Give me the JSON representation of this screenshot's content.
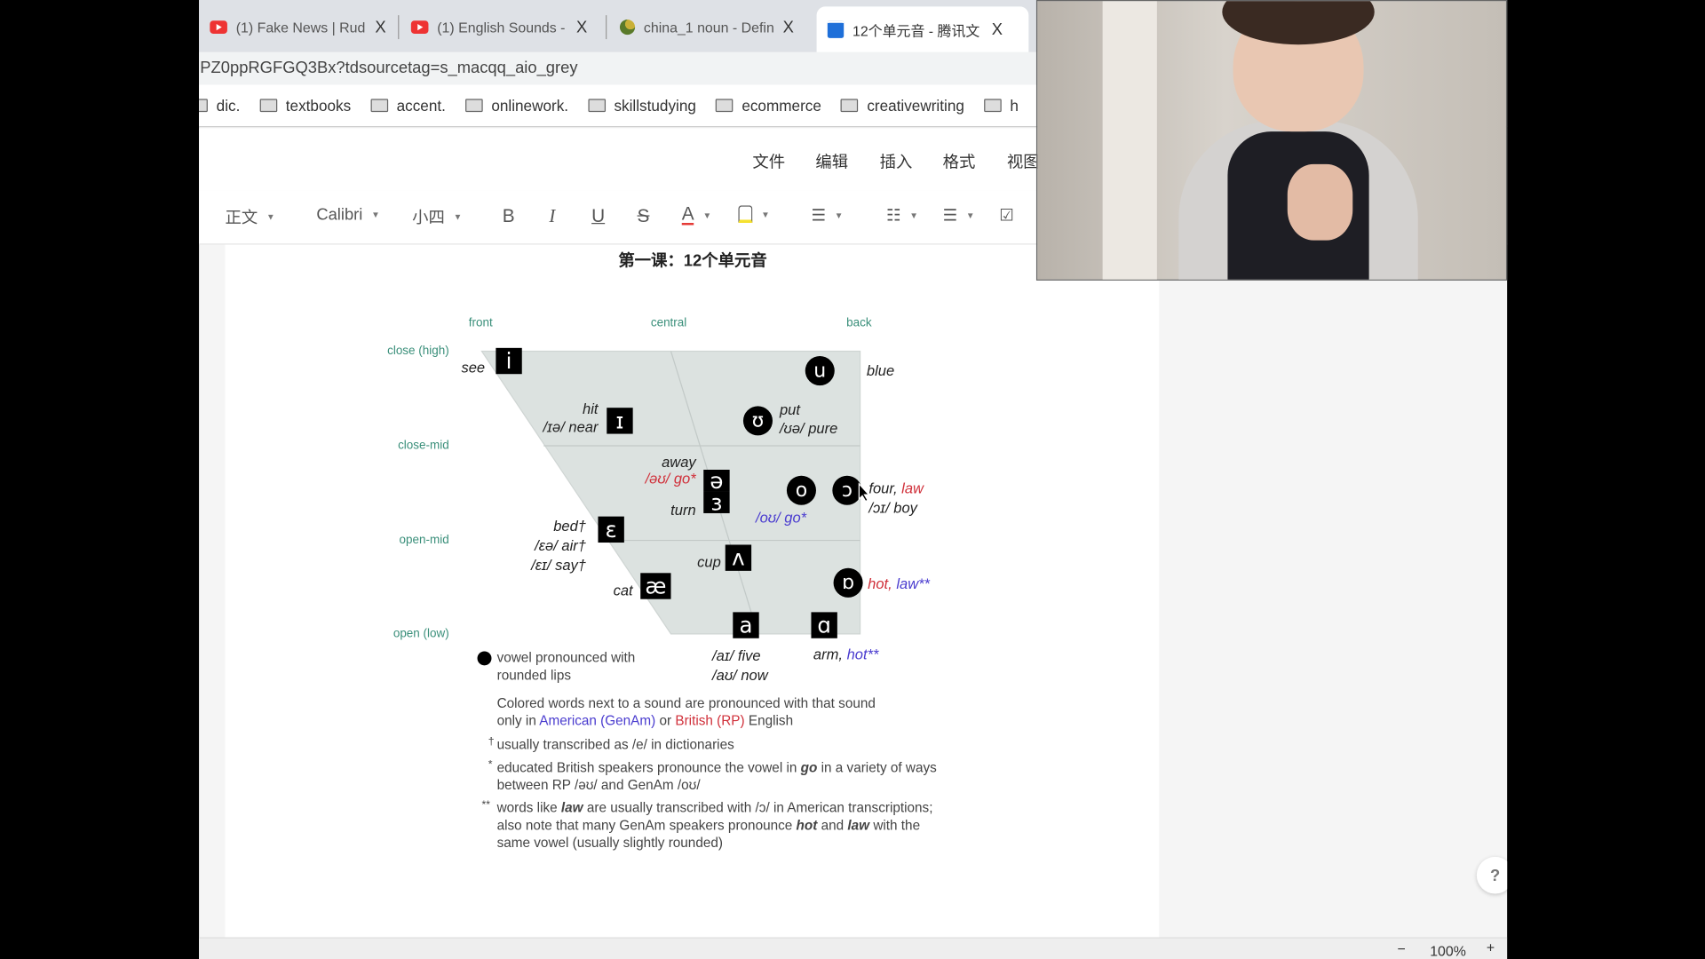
{
  "browser": {
    "tabs": [
      {
        "title": "(1) Fake News | Rud",
        "icon": "youtube-icon"
      },
      {
        "title": "(1) English Sounds -",
        "icon": "youtube-icon"
      },
      {
        "title": "china_1 noun - Defin",
        "icon": "dictionary-icon"
      },
      {
        "title": "12个单元音 - 腾讯文",
        "icon": "tencent-docs-icon",
        "active": true
      }
    ],
    "close_label": "X",
    "address": "PZ0ppRGFGQ3Bx?tdsourcetag=s_macqq_aio_grey",
    "bookmarks": [
      "dic.",
      "textbooks",
      "accent.",
      "onlinework.",
      "skillstudying",
      "ecommerce",
      "creativewriting",
      "h"
    ]
  },
  "menu": [
    "文件",
    "编辑",
    "插入",
    "格式",
    "视图"
  ],
  "toolbar": {
    "style": "正文",
    "font": "Calibri",
    "size": "小四",
    "bold": "B",
    "italic": "I",
    "underline": "U",
    "strike": "S",
    "font_color": "A",
    "text_color": "#e53935",
    "highlight_color": "#f5e130"
  },
  "document": {
    "title": "第一课：12个单元音",
    "axes": {
      "front": "front",
      "central": "central",
      "back": "back",
      "close": "close (high)",
      "close_mid": "close-mid",
      "open_mid": "open-mid",
      "open": "open (low)"
    },
    "symbols": {
      "i": "i",
      "u": "u",
      "I": "ɪ",
      "U": "ʊ",
      "schwa": "ə",
      "er": "ɜ",
      "o": "o",
      "open_o": "ɔ",
      "e": "ɛ",
      "v": "ʌ",
      "ae": "æ",
      "ob": "ɒ",
      "a": "a",
      "aa": "ɑ"
    },
    "words": {
      "see": "see",
      "blue": "blue",
      "hit": "hit",
      "near": "/ɪə/ near",
      "put": "put",
      "pure": "/ʊə/ pure",
      "away": "away",
      "go_rp": "/əʊ/ go*",
      "turn": "turn",
      "four": "four, ",
      "law": "law",
      "boy": "/ɔɪ/ boy",
      "go_am": "/oʊ/ go*",
      "bed": "bed†",
      "air": "/ɛə/ air†",
      "say": "/ɛɪ/ say†",
      "cup": "cup",
      "cat": "cat",
      "hot": "hot, ",
      "law2": "law**",
      "five": "/aɪ/ five",
      "now": "/aʊ/ now",
      "arm": "arm, ",
      "hot2": "hot**"
    },
    "legend": {
      "l1": "vowel pronounced with",
      "l2": "rounded lips"
    },
    "notes": {
      "p1": "Colored words next to a sound are pronounced with that sound",
      "p2a": "only in ",
      "american": "American (GenAm)",
      "p2b": " or ",
      "british": "British (RP)",
      "p2c": " English",
      "dagger": "†",
      "n1": "usually transcribed as /e/ in dictionaries",
      "star": "*",
      "n2a": "educated British speakers pronounce the vowel in ",
      "n2go": "go",
      "n2b": " in a variety of ways",
      "n2c": "between RP /əʊ/ and GenAm /oʊ/",
      "dstar": "**",
      "n3a": "words like ",
      "n3law": "law",
      "n3b": " are usually transcribed with /ɔ/ in American transcriptions;",
      "n3c": "also note that many GenAm speakers pronounce ",
      "n3hot": "hot",
      "n3d": " and ",
      "n3law2": "law",
      "n3e": " with the",
      "n3f": "same vowel (usually slightly rounded)"
    },
    "colors": {
      "american": "#4a3ccf",
      "british": "#d0303a",
      "axis_label": "#3a8f7a",
      "chart_fill": "#dce2e0"
    }
  },
  "status": {
    "zoom": "100%",
    "minus": "−",
    "plus": "+"
  },
  "help": "?"
}
